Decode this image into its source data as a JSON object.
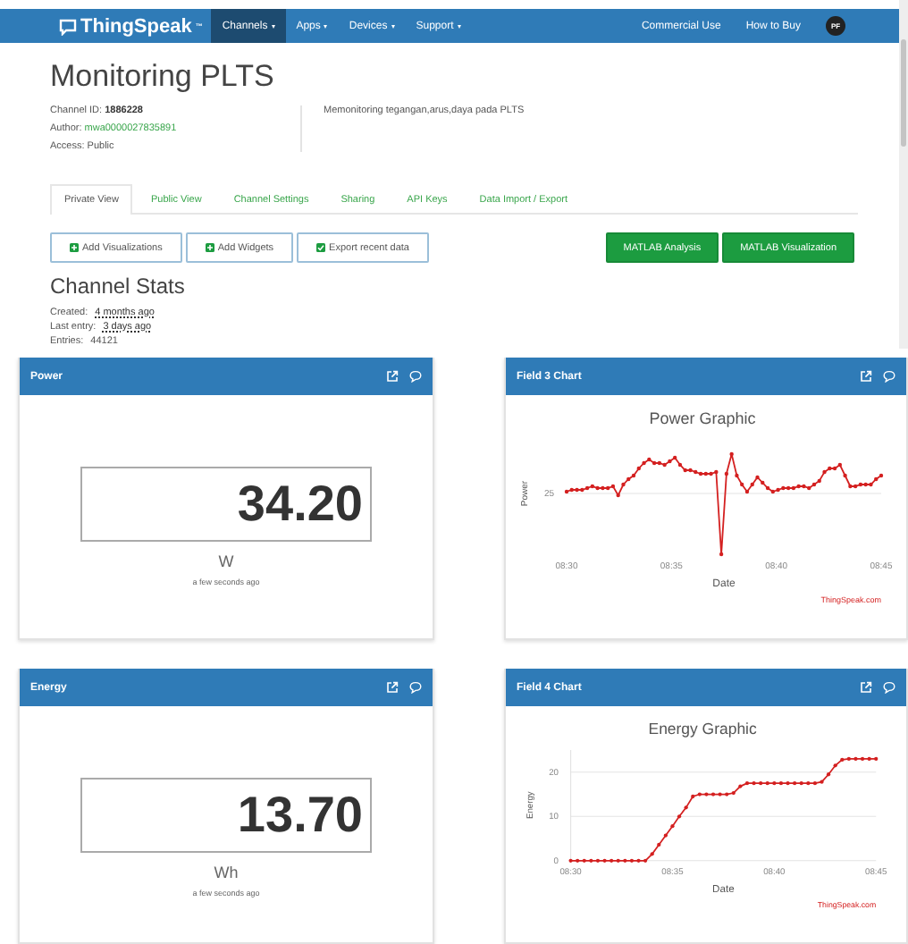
{
  "nav": {
    "logo": "ThingSpeak",
    "logo_mark": "™",
    "menus": [
      {
        "label": "Channels",
        "selected": true
      },
      {
        "label": "Apps",
        "selected": false
      },
      {
        "label": "Devices",
        "selected": false
      },
      {
        "label": "Support",
        "selected": false
      }
    ],
    "links": [
      "Commercial Use",
      "How to Buy"
    ],
    "avatar": "PF"
  },
  "channel": {
    "title": "Monitoring PLTS",
    "id_label": "Channel ID:",
    "id": "1886228",
    "author_label": "Author:",
    "author": "mwa0000027835891",
    "access": "Access: Public",
    "description": "Memonitoring tegangan,arus,daya pada PLTS"
  },
  "tabs": [
    {
      "label": "Private View",
      "selected": true
    },
    {
      "label": "Public View",
      "selected": false
    },
    {
      "label": "Channel Settings",
      "selected": false
    },
    {
      "label": "Sharing",
      "selected": false
    },
    {
      "label": "API Keys",
      "selected": false
    },
    {
      "label": "Data Import / Export",
      "selected": false
    }
  ],
  "buttons": [
    {
      "label": "Add Visualizations",
      "kind": "add"
    },
    {
      "label": "Add Widgets",
      "kind": "add"
    },
    {
      "label": "Export recent data",
      "kind": "export"
    },
    {
      "label": "MATLAB Analysis",
      "kind": "matlab"
    },
    {
      "label": "MATLAB Visualization",
      "kind": "matlab"
    }
  ],
  "stats": {
    "title": "Channel Stats",
    "rows": [
      {
        "label": "Created:",
        "value": "4 months ago",
        "kind": "time"
      },
      {
        "label": "Last entry:",
        "value": "3 days ago",
        "kind": "time"
      },
      {
        "label": "Entries:",
        "value": "44121",
        "kind": "count"
      }
    ]
  },
  "widgets": [
    {
      "kind": "numeric",
      "title": "Power",
      "value": "34.20",
      "unit": "W",
      "updated": "a few seconds ago"
    },
    {
      "kind": "chart",
      "title": "Field 3 Chart",
      "chart": {
        "title": "Power Graphic",
        "xlabel": "Date",
        "ylabel": "Power",
        "ytick_labels": [
          "25"
        ],
        "xtick_labels": [
          "08:30",
          "08:35",
          "08:40",
          "08:45"
        ]
      },
      "credit": "ThingSpeak.com"
    },
    {
      "kind": "numeric",
      "title": "Energy",
      "value": "13.70",
      "unit": "Wh",
      "updated": "a few seconds ago"
    },
    {
      "kind": "chart",
      "title": "Field 4 Chart",
      "chart_data": {
        "type": "line",
        "title": "Energy Graphic",
        "xlabel": "Date",
        "ylabel": "Energy",
        "categories": [
          "08:30",
          null,
          null,
          null,
          null,
          null,
          null,
          null,
          null,
          null,
          null,
          null,
          null,
          null,
          null,
          "08:35",
          null,
          null,
          null,
          null,
          null,
          null,
          null,
          null,
          null,
          null,
          null,
          null,
          null,
          null,
          "08:40",
          null,
          null,
          null,
          null,
          null,
          null,
          null,
          null,
          null,
          null,
          null,
          null,
          null,
          null,
          "08:45"
        ],
        "series": [
          {
            "color": "#d42020",
            "values": [
              0,
              0,
              0,
              0,
              0,
              0,
              0,
              0,
              0,
              0,
              0,
              0,
              1.5,
              3.6,
              5.7,
              7.8,
              10,
              12,
              14.5,
              15,
              15,
              15,
              15,
              15,
              15.3,
              16.8,
              17.5,
              17.5,
              17.5,
              17.5,
              17.5,
              17.5,
              17.5,
              17.5,
              17.5,
              17.5,
              17.5,
              17.8,
              19.5,
              21.5,
              22.8,
              23,
              23,
              23,
              23,
              23
            ]
          }
        ],
        "ylim": [
          0,
          25
        ],
        "yticks": [
          0,
          10,
          20
        ]
      },
      "credit": "ThingSpeak.com"
    }
  ]
}
